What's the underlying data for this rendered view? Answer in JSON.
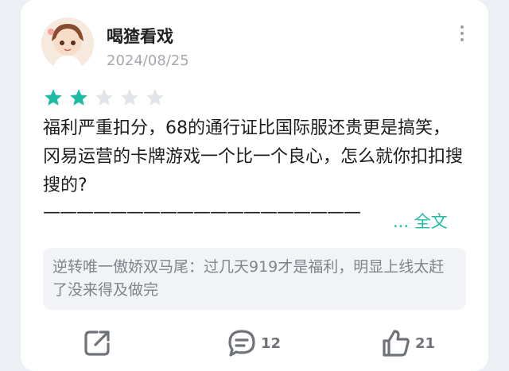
{
  "review": {
    "username": "喝猹看戏",
    "date": "2024/08/25",
    "rating": {
      "filled": 2,
      "total": 5
    },
    "content": "福利严重扣分，68的通行证比国际服还贵更是搞笑，冈易运营的卡牌游戏一个比一个良心，怎么就你扣扣搜搜的?",
    "divider": "———————————————————",
    "full_text_label": "... 全文",
    "reply": "逆转唯一傲娇双马尾：过几天919才是福利，明显上线太赶了没来得及做完",
    "actions": {
      "share_icon": "share-icon",
      "comment_icon": "comment-icon",
      "comment_count": "12",
      "like_icon": "thumbs-up-icon",
      "like_count": "21"
    }
  },
  "colors": {
    "accent": "#1dbba5",
    "star_empty": "#e1e4e8",
    "reply_bg": "#f1f3f6",
    "icon": "#6f7378"
  }
}
